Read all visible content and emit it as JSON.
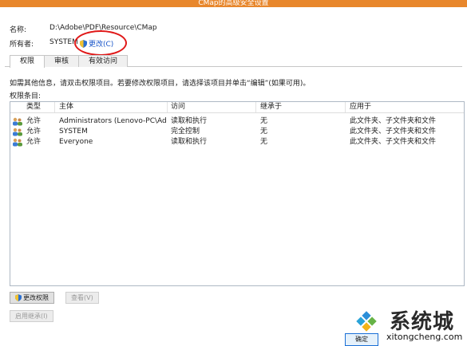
{
  "window": {
    "title": "CMap的高级安全设置"
  },
  "info": {
    "name_label": "名称:",
    "name_value": "D:\\Adobe\\PDF\\Resource\\CMap",
    "owner_label": "所有者:",
    "owner_value": "SYSTEM",
    "change_link": "更改(C)"
  },
  "tabs": [
    {
      "label": "权限",
      "active": true
    },
    {
      "label": "审核",
      "active": false
    },
    {
      "label": "有效访问",
      "active": false
    }
  ],
  "description": "如需其他信息，请双击权限项目。若要修改权限项目，请选择该项目并单击“编辑”(如果可用)。",
  "entries_label": "权限条目:",
  "table": {
    "headers": [
      "类型",
      "主体",
      "访问",
      "继承于",
      "应用于"
    ],
    "rows": [
      {
        "type": "允许",
        "principal": "Administrators (Lenovo-PC\\Admi...",
        "access": "读取和执行",
        "inherited": "无",
        "applies": "此文件夹、子文件夹和文件"
      },
      {
        "type": "允许",
        "principal": "SYSTEM",
        "access": "完全控制",
        "inherited": "无",
        "applies": "此文件夹、子文件夹和文件"
      },
      {
        "type": "允许",
        "principal": "Everyone",
        "access": "读取和执行",
        "inherited": "无",
        "applies": "此文件夹、子文件夹和文件"
      }
    ]
  },
  "buttons": {
    "change_permissions": "更改权限",
    "view": "查看(V)",
    "enable_inheritance": "启用继承(I)",
    "ok_partial": "确定"
  },
  "watermark": {
    "brand": "系统城",
    "url": "xitongcheng.com"
  },
  "colors": {
    "titlebar": "#e8872c",
    "link": "#1a56c9",
    "highlight_circle": "#e01818"
  }
}
